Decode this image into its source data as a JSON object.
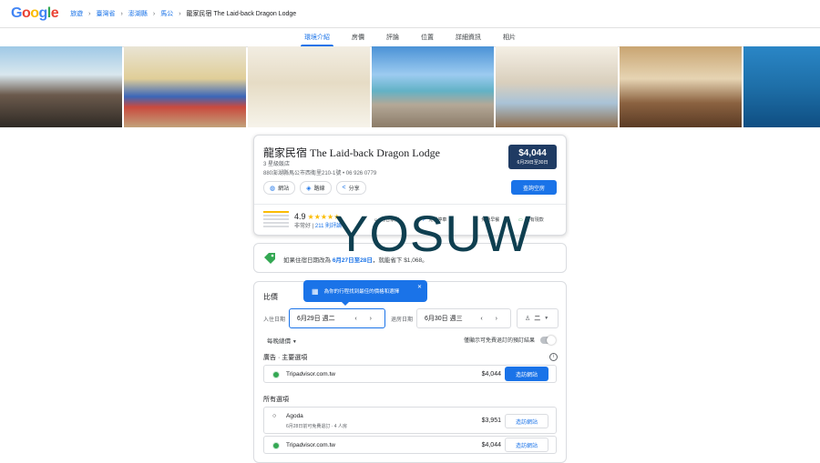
{
  "header": {
    "logo": "Google",
    "breadcrumbs": [
      "旅遊",
      "臺灣省",
      "澎湖縣",
      "馬公"
    ],
    "current": "龍家民宿 The Laid-back Dragon Lodge"
  },
  "tabs": [
    "環境介紹",
    "房價",
    "評論",
    "位置",
    "詳細資訊",
    "相片"
  ],
  "hotel": {
    "name": "龍家民宿 The Laid-back Dragon Lodge",
    "class": "3 星級飯店",
    "address": "880澎湖縣馬公市西衛里210-1號",
    "phone": "06 926 0779",
    "price": "$4,044",
    "price_dates": "6月29日至30日",
    "chips": [
      "網站",
      "路線",
      "分享"
    ],
    "check_button": "查詢空房",
    "rating": "4.9",
    "rating_word": "非常好",
    "review_count": "211 則評論",
    "amenities": [
      "適合家庭",
      "免費停車",
      "免費早餐",
      "擁有現款"
    ]
  },
  "promo": {
    "prefix": "如果住宿日期改為",
    "dates": "6月27日至28日",
    "suffix": "，就能省下 $1,068。"
  },
  "prices": {
    "title": "比價",
    "tooltip": "為你的行程找到最佳的價格和選擇",
    "checkin_label": "入住日期",
    "checkin_value": "6月29日 週二",
    "checkout_label": "退房日期",
    "checkout_value": "6月30日 週三",
    "guests": "二",
    "per_night": "每晚總價",
    "free_cancel": "僅顯示可免費退訂的預訂結果",
    "ads_title": "廣告 · 主要選項",
    "all_title": "所有選項",
    "offers_ads": [
      {
        "provider": "Tripadvisor.com.tw",
        "price": "$4,044",
        "button": "造訪網站"
      }
    ],
    "offers_all": [
      {
        "provider": "Agoda",
        "note": "6月28日前可免費退訂 · 4 人房",
        "price": "$3,951",
        "button": "造訪網站"
      },
      {
        "provider": "Tripadvisor.com.tw",
        "price": "$4,044",
        "button": "造訪網站"
      }
    ]
  },
  "watermark": "YOSUW"
}
